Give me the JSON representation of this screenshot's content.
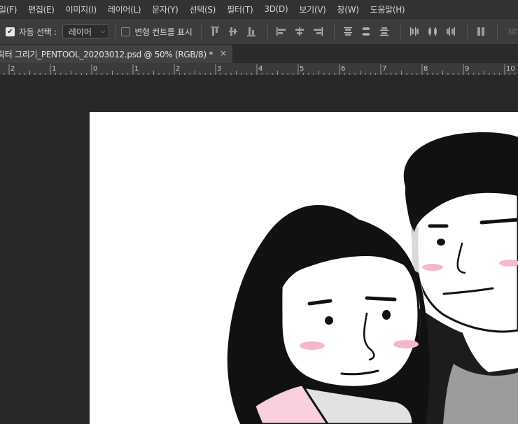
{
  "menu": {
    "items": [
      "일(F)",
      "편집(E)",
      "이미지(I)",
      "레이어(L)",
      "문자(Y)",
      "선택(S)",
      "필터(T)",
      "3D(D)",
      "보기(V)",
      "창(W)",
      "도움말(H)"
    ]
  },
  "options": {
    "auto_select_label": "자동 선택 :",
    "auto_select_checked": true,
    "target_value": "레이어",
    "transform_controls_label": "변형 컨트롤 표시",
    "transform_controls_checked": false,
    "mode_3d_label": "3D"
  },
  "document": {
    "tab_title": "릭터 그리기_PENTOOL_20203012.psd @ 50% (RGB/8) *",
    "close_glyph": "×"
  },
  "ruler": {
    "labels": [
      "2",
      "1",
      "0",
      "1",
      "2",
      "3",
      "4",
      "5",
      "6",
      "7",
      "8",
      "9",
      "10"
    ]
  },
  "colors": {
    "chrome_dark": "#282828",
    "menubar": "#323232",
    "optionsbar": "#3c3c3c",
    "active_tab": "#424242",
    "canvas": "#ffffff",
    "blush": "#f5b8c8",
    "hair": "#0f0f0f"
  }
}
